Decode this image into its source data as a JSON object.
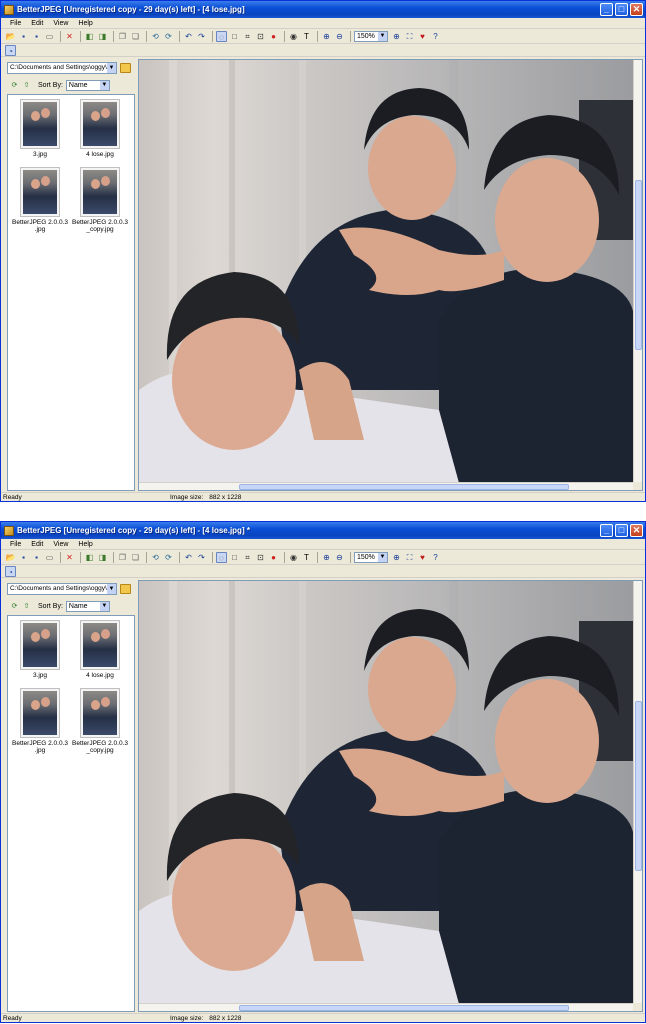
{
  "windows": [
    {
      "title": "BetterJPEG [Unregistered copy - 29 day(s) left] - [4 lose.jpg]",
      "menu": [
        "File",
        "Edit",
        "View",
        "Help"
      ],
      "zoom": "150%",
      "path": "C:\\Documents and Settings\\oggy\\D",
      "sort_label": "Sort By:",
      "sort_value": "Name",
      "thumbs": [
        {
          "caption": "3.jpg"
        },
        {
          "caption": "4 lose.jpg"
        },
        {
          "caption": "BetterJPEG 2.0.0.3\n.jpg"
        },
        {
          "caption": "BetterJPEG 2.0.0.3\n_copy.jpg"
        }
      ],
      "status": {
        "ready": "Ready",
        "size_label": "Image size:",
        "size_value": "882 x 1228"
      }
    },
    {
      "title": "BetterJPEG [Unregistered copy - 29 day(s) left] - [4 lose.jpg] *",
      "menu": [
        "File",
        "Edit",
        "View",
        "Help"
      ],
      "zoom": "150%",
      "path": "C:\\Documents and Settings\\oggy\\D",
      "sort_label": "Sort By:",
      "sort_value": "Name",
      "thumbs": [
        {
          "caption": "3.jpg"
        },
        {
          "caption": "4 lose.jpg"
        },
        {
          "caption": "BetterJPEG 2.0.0.3\n.jpg"
        },
        {
          "caption": "BetterJPEG 2.0.0.3\n_copy.jpg"
        }
      ],
      "status": {
        "ready": "Ready",
        "size_label": "Image size:",
        "size_value": "882 x 1228"
      }
    }
  ],
  "icons": {
    "toolbar": [
      "open-folder-icon",
      "save-icon",
      "save-as-icon",
      "print-icon",
      "delete-icon",
      "prev-image-icon",
      "next-image-icon",
      "copy-icon",
      "paste-icon",
      "rotate-left-icon",
      "rotate-right-icon",
      "undo-icon",
      "redo-icon",
      "select-tool-icon",
      "rectangle-select-icon",
      "crop-icon",
      "resize-icon",
      "red-eye-icon",
      "eye-icon",
      "text-icon",
      "zoom-in-icon",
      "zoom-out-icon",
      "zoom-fit-icon",
      "fit-window-icon",
      "heart-icon",
      "help-icon"
    ]
  },
  "colors": {
    "titlebar": "#0a4fd6",
    "window_bg": "#ece9d8",
    "border": "#7f9db9"
  }
}
